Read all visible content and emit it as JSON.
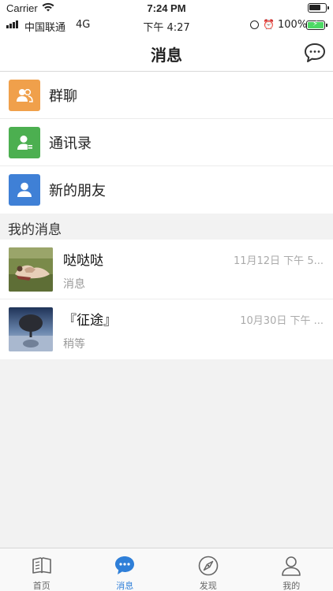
{
  "sim_status": {
    "carrier": "Carrier",
    "time": "7:24 PM"
  },
  "device_status": {
    "carrier": "中国联通",
    "network": "4G",
    "time": "下午 4:27",
    "battery": "100%"
  },
  "navbar": {
    "title": "消息"
  },
  "menu": [
    {
      "label": "群聊",
      "icon": "group-icon",
      "color": "#f0a04b"
    },
    {
      "label": "通讯录",
      "icon": "contacts-icon",
      "color": "#4caf50"
    },
    {
      "label": "新的朋友",
      "icon": "new-friend-icon",
      "color": "#3f80d6"
    }
  ],
  "section": {
    "label": "我的消息"
  },
  "messages": [
    {
      "name": "哒哒哒",
      "preview": "消息",
      "date": "11月12日 下午 5..."
    },
    {
      "name": "『征途』",
      "preview": "稍等",
      "date": "10月30日 下午 ..."
    }
  ],
  "tabs": [
    {
      "label": "首页",
      "icon": "book-icon",
      "active": false
    },
    {
      "label": "消息",
      "icon": "chat-bubble-icon",
      "active": true
    },
    {
      "label": "发现",
      "icon": "compass-icon",
      "active": false
    },
    {
      "label": "我的",
      "icon": "person-icon",
      "active": false
    }
  ],
  "colors": {
    "accent": "#2f7fd8",
    "background": "#f2f2f2"
  }
}
